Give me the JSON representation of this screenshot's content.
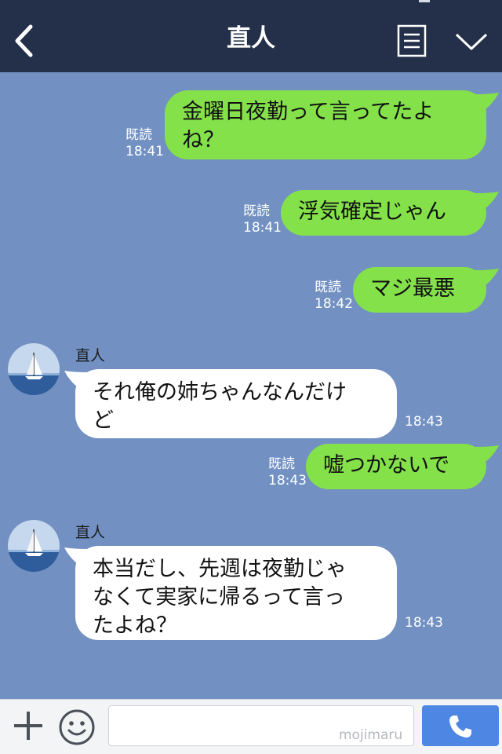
{
  "header": {
    "title": "直人",
    "back_icon": "chevron-left-icon",
    "menu_icon": "list-icon",
    "expand_icon": "chevron-down-icon"
  },
  "messages": [
    {
      "direction": "out",
      "read_label": "既読",
      "time": "18:41",
      "lines": [
        "金曜日夜勤って言ってたよ",
        "ね？"
      ]
    },
    {
      "direction": "out",
      "read_label": "既読",
      "time": "18:41",
      "lines": [
        "浮気確定じゃん"
      ]
    },
    {
      "direction": "out",
      "read_label": "既読",
      "time": "18:42",
      "lines": [
        "マジ最悪"
      ]
    },
    {
      "direction": "in",
      "sender": "直人",
      "time": "18:43",
      "lines": [
        "それ俺の姉ちゃんなんだけ",
        "ど"
      ]
    },
    {
      "direction": "out",
      "read_label": "既読",
      "time": "18:43",
      "lines": [
        "嘘つかないで"
      ]
    },
    {
      "direction": "in",
      "sender": "直人",
      "time": "18:43",
      "lines": [
        "本当だし、先週は夜勤じゃ",
        "なくて実家に帰るって言っ",
        "たよね？"
      ]
    }
  ],
  "composer": {
    "input_value": "",
    "watermark": "mojimaru",
    "plus_icon": "plus-icon",
    "emoji_icon": "smile-icon",
    "call_icon": "phone-icon"
  },
  "colors": {
    "header_bg": "#243049",
    "chat_bg": "#7291c2",
    "outgoing_bubble": "#84e14a",
    "incoming_bubble": "#ffffff",
    "call_button": "#4d87e3"
  }
}
